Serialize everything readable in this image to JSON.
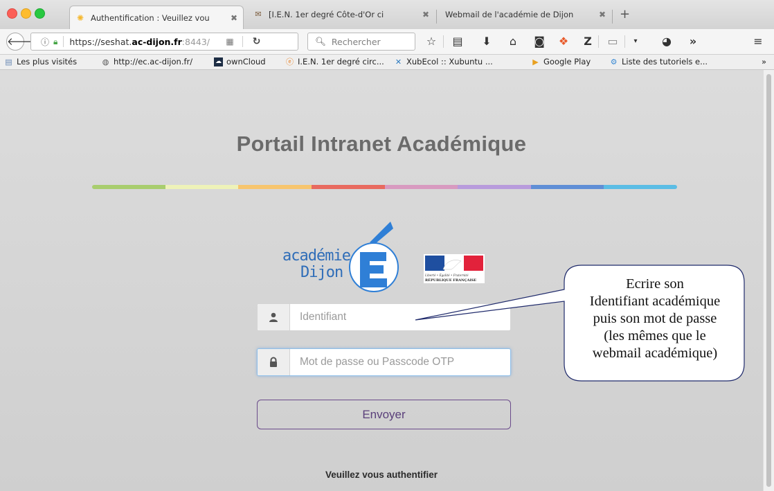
{
  "browser": {
    "tabs": [
      {
        "label": "Authentification : Veuillez vou",
        "icon": "sun-icon",
        "active": true
      },
      {
        "label": "[I.E.N. 1er degré Côte-d'Or ci",
        "icon": "mail-icon",
        "active": false
      },
      {
        "label": "Webmail de l'académie de Dijon",
        "icon": "",
        "active": false
      }
    ],
    "new_tab_label": "+",
    "address_bar": {
      "url_prefix": "https://seshat.",
      "url_domain": "ac-dijon.fr",
      "url_suffix": ":8443/"
    },
    "search_placeholder": "Rechercher",
    "toolbar_icons": [
      "star-icon",
      "reading-list-icon",
      "download-icon",
      "home-icon",
      "pocket-icon",
      "addon-icon",
      "zotero-icon",
      "notes-icon",
      "dropdown-icon",
      "circle-addon-icon",
      "overflow-icon",
      "menu-icon"
    ],
    "bookmarks": [
      {
        "label": "Les plus visités",
        "icon": "most-visited-icon"
      },
      {
        "label": "http://ec.ac-dijon.fr/",
        "icon": "globe-icon"
      },
      {
        "label": "ownCloud",
        "icon": "owncloud-icon"
      },
      {
        "label": "I.E.N. 1er degré circ...",
        "icon": "ien-icon"
      },
      {
        "label": "XubEcol :: Xubuntu ...",
        "icon": "xubuntu-icon"
      },
      {
        "label": "Google Play",
        "icon": "google-play-icon"
      },
      {
        "label": "Liste des tutoriels e...",
        "icon": "tutorial-icon"
      }
    ],
    "bookmarks_overflow": "»"
  },
  "page": {
    "title": "Portail Intranet Académique",
    "rainbow_colors": [
      "#a8cd6e",
      "#eef2b8",
      "#f7c56e",
      "#e86a5f",
      "#d89ac0",
      "#b89bdc",
      "#5f8ed6",
      "#5bbde5"
    ],
    "logo": {
      "line1": "académie",
      "line2": "Dijon",
      "accent_color": "#2f7fd6",
      "marianne_caption": "Liberté • Égalité • Fraternité",
      "marianne_republic": "RÉPUBLIQUE FRANÇAISE"
    },
    "username_placeholder": "Identifiant",
    "password_placeholder": "Mot de passe ou Passcode OTP",
    "submit_label": "Envoyer",
    "footer_message": "Veuillez vous authentifier"
  },
  "callout": {
    "lines": [
      "Ecrire son",
      "Identifiant académique",
      "puis son mot de passe",
      "(les mêmes que le",
      "webmail académique)"
    ]
  }
}
